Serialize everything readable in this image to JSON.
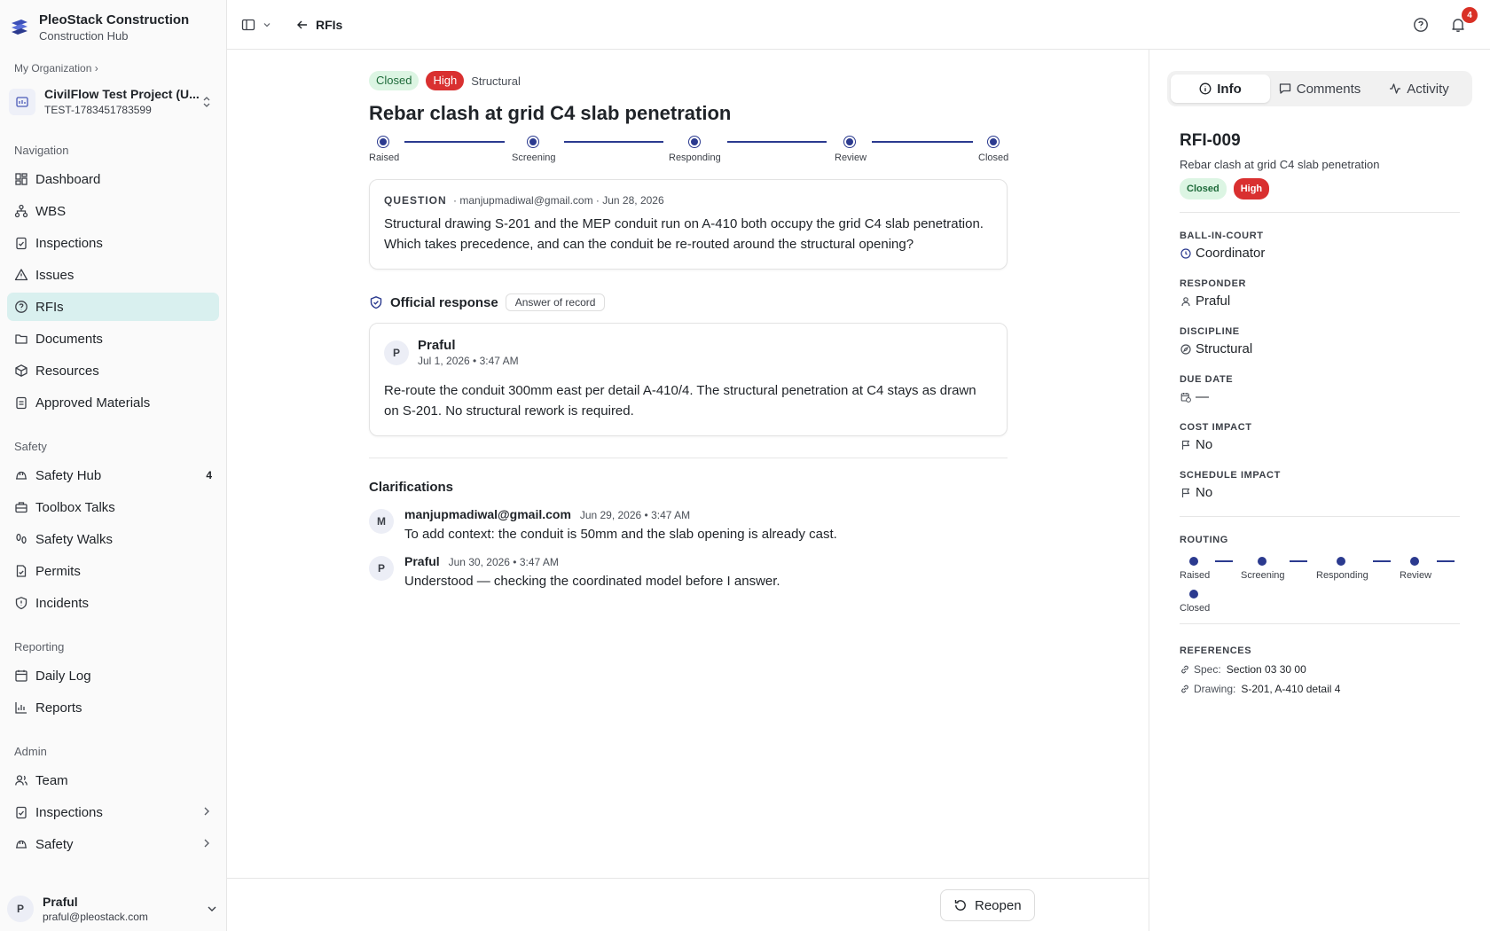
{
  "brand": {
    "title": "PleoStack Construction",
    "subtitle": "Construction Hub"
  },
  "org_crumb": "My Organization ›",
  "project": {
    "name": "CivilFlow Test Project (U...",
    "code": "TEST-1783451783599"
  },
  "nav": {
    "navigation_label": "Navigation",
    "navigation": [
      {
        "label": "Dashboard",
        "icon": "dashboard-icon"
      },
      {
        "label": "WBS",
        "icon": "hierarchy-icon"
      },
      {
        "label": "Inspections",
        "icon": "clipboard-check-icon"
      },
      {
        "label": "Issues",
        "icon": "warning-triangle-icon"
      },
      {
        "label": "RFIs",
        "icon": "question-circle-icon"
      },
      {
        "label": "Documents",
        "icon": "folder-icon"
      },
      {
        "label": "Resources",
        "icon": "box-icon"
      },
      {
        "label": "Approved Materials",
        "icon": "clipboard-icon"
      }
    ],
    "safety_label": "Safety",
    "safety": [
      {
        "label": "Safety Hub",
        "count": "4",
        "icon": "hard-hat-icon"
      },
      {
        "label": "Toolbox Talks",
        "icon": "briefcase-icon"
      },
      {
        "label": "Safety Walks",
        "icon": "footprints-icon"
      },
      {
        "label": "Permits",
        "icon": "file-check-icon"
      },
      {
        "label": "Incidents",
        "icon": "shield-alert-icon"
      }
    ],
    "reporting_label": "Reporting",
    "reporting": [
      {
        "label": "Daily Log",
        "icon": "calendar-icon"
      },
      {
        "label": "Reports",
        "icon": "bar-chart-icon"
      }
    ],
    "admin_label": "Admin",
    "admin": [
      {
        "label": "Team",
        "icon": "users-icon"
      },
      {
        "label": "Inspections",
        "icon": "clipboard-check-icon"
      },
      {
        "label": "Safety",
        "icon": "hard-hat-icon"
      }
    ]
  },
  "user": {
    "initial": "P",
    "name": "Praful",
    "email": "praful@pleostack.com"
  },
  "topbar": {
    "back_label": "RFIs",
    "notification_count": "4"
  },
  "rfi": {
    "status": "Closed",
    "priority": "High",
    "discipline": "Structural",
    "title": "Rebar clash at grid C4 slab penetration",
    "steps": [
      "Raised",
      "Screening",
      "Responding",
      "Review",
      "Closed"
    ],
    "question": {
      "label": "QUESTION",
      "meta": "· manjupmadiwal@gmail.com · Jun 28, 2026",
      "text": "Structural drawing S-201 and the MEP conduit run on A-410 both occupy the grid C4 slab penetration. Which takes precedence, and can the conduit be re-routed around the structural opening?"
    },
    "response": {
      "heading": "Official response",
      "pill": "Answer of record",
      "author_initial": "P",
      "author": "Praful",
      "date": "Jul 1, 2026 • 3:47 AM",
      "text": "Re-route the conduit 300mm east per detail A-410/4. The structural penetration at C4 stays as drawn on S-201. No structural rework is required."
    },
    "clarifications_heading": "Clarifications",
    "clarifications": [
      {
        "initial": "M",
        "author": "manjupmadiwal@gmail.com",
        "date": "Jun 29, 2026 • 3:47 AM",
        "text": "To add context: the conduit is 50mm and the slab opening is already cast."
      },
      {
        "initial": "P",
        "author": "Praful",
        "date": "Jun 30, 2026 • 3:47 AM",
        "text": "Understood — checking the coordinated model before I answer."
      }
    ],
    "reopen_label": "Reopen"
  },
  "panel": {
    "tabs": [
      "Info",
      "Comments",
      "Activity"
    ],
    "number": "RFI-009",
    "subtitle": "Rebar clash at grid C4 slab penetration",
    "status": "Closed",
    "priority": "High",
    "fields": [
      {
        "label": "BALL-IN-COURT",
        "value": "Coordinator",
        "icon": "clock-icon"
      },
      {
        "label": "RESPONDER",
        "value": "Praful",
        "icon": "user-icon"
      },
      {
        "label": "DISCIPLINE",
        "value": "Structural",
        "icon": "compass-icon"
      },
      {
        "label": "DUE DATE",
        "value": "—",
        "icon": "calendar-clock-icon"
      },
      {
        "label": "COST IMPACT",
        "value": "No",
        "icon": "flag-icon"
      },
      {
        "label": "SCHEDULE IMPACT",
        "value": "No",
        "icon": "flag-icon"
      }
    ],
    "routing_label": "ROUTING",
    "routing_steps": [
      "Raised",
      "Screening",
      "Responding",
      "Review",
      "Closed"
    ],
    "references_label": "REFERENCES",
    "references": [
      {
        "key": "Spec:",
        "value": "Section 03 30 00"
      },
      {
        "key": "Drawing:",
        "value": "S-201, A-410 detail 4"
      }
    ]
  },
  "colors": {
    "accent": "#2b3a8f",
    "active_nav": "#d9f0ef",
    "closed_bg": "#dcf5e3",
    "high_bg": "#d93030"
  }
}
